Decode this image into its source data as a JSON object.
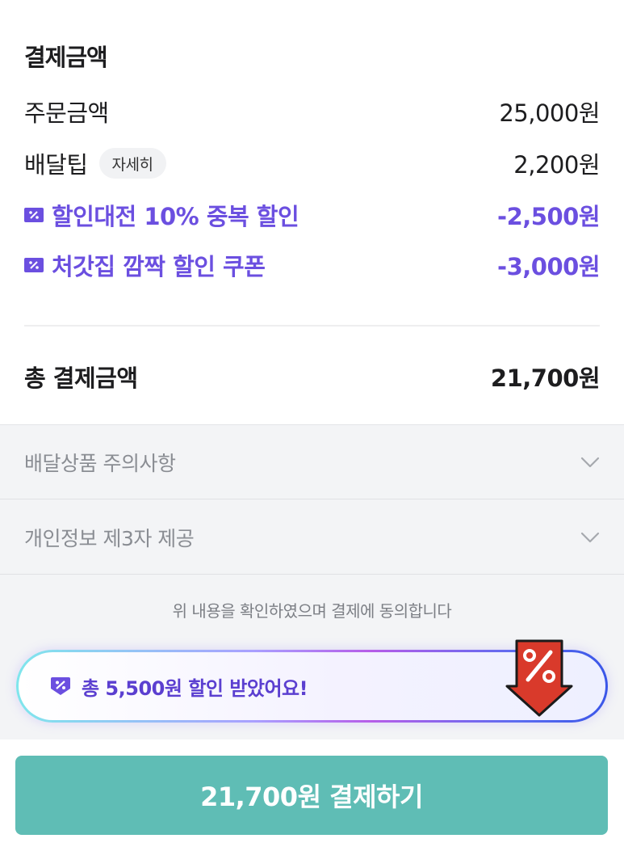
{
  "summary": {
    "title": "결제금액",
    "order_amount": {
      "label": "주문금액",
      "value": "25,000원"
    },
    "delivery_tip": {
      "label": "배달팁",
      "detail_label": "자세히",
      "value": "2,200원"
    },
    "discounts": [
      {
        "label": "할인대전 10% 중복 할인",
        "value": "-2,500원",
        "icon": "coupon-icon"
      },
      {
        "label": "처갓집 깜짝 할인 쿠폰",
        "value": "-3,000원",
        "icon": "coupon-icon"
      }
    ],
    "total": {
      "label": "총 결제금액",
      "value": "21,700원"
    }
  },
  "accordions": [
    {
      "label": "배달상품 주의사항",
      "icon": "chevron-down-icon"
    },
    {
      "label": "개인정보 제3자 제공",
      "icon": "chevron-down-icon"
    }
  ],
  "agreement_text": "위 내용을 확인하였으며 결제에 동의합니다",
  "banner": {
    "text": "총 5,500원 할인 받았어요!",
    "icon": "discount-badge-icon",
    "graphic": "percent-tag-arrow-icon"
  },
  "pay_button": {
    "label": "21,700원 결제하기"
  },
  "colors": {
    "discount": "#6b4fe0",
    "button": "#5fbdb5",
    "banner_text": "#5b3fd0"
  }
}
